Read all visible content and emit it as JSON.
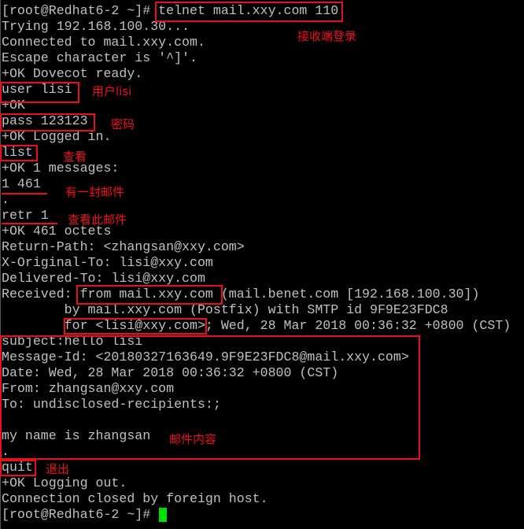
{
  "terminal": {
    "lines": [
      "[root@Redhat6-2 ~]# telnet mail.xxy.com 110",
      "Trying 192.168.100.30...",
      "Connected to mail.xxy.com.",
      "Escape character is '^]'.",
      "+OK Dovecot ready.",
      "user lisi",
      "+OK",
      "pass 123123",
      "+OK Logged in.",
      "list",
      "+OK 1 messages:",
      "1 461",
      ".",
      "retr 1",
      "+OK 461 octets",
      "Return-Path: <zhangsan@xxy.com>",
      "X-Original-To: lisi@xxy.com",
      "Delivered-To: lisi@xxy.com",
      "Received: from mail.xxy.com (mail.benet.com [192.168.100.30])",
      "        by mail.xxy.com (Postfix) with SMTP id 9F9E23FDC8",
      "        for <lisi@xxy.com>; Wed, 28 Mar 2018 00:36:32 +0800 (CST)",
      "subject:hello lisi",
      "Message-Id: <20180327163649.9F9E23FDC8@mail.xxy.com>",
      "Date: Wed, 28 Mar 2018 00:36:32 +0800 (CST)",
      "From: zhangsan@xxy.com",
      "To: undisclosed-recipients:;",
      "",
      "my name is zhangsan",
      ".",
      "quit",
      "+OK Logging out.",
      "Connection closed by foreign host.",
      "[root@Redhat6-2 ~]# "
    ]
  },
  "annotations": {
    "login": "接收端登录",
    "user": "用户lisi",
    "password": "密码",
    "list": "查看",
    "one_mail": "有一封邮件",
    "view_mail": "查看此邮件",
    "content": "邮件内容",
    "quit": "退出"
  },
  "colors": {
    "annotation": "#e8101e",
    "text": "#c0c0c0",
    "background": "#000000",
    "cursor": "#00e000"
  }
}
